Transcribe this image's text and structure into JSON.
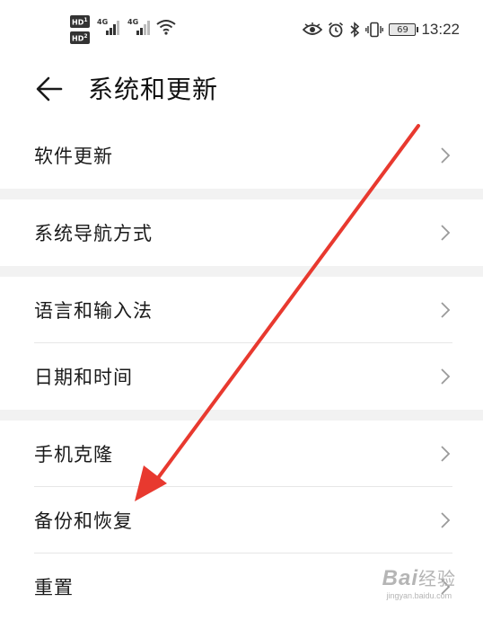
{
  "status_bar": {
    "sim1_label": "HD",
    "sim1_index": "1",
    "sim2_label": "HD",
    "sim2_index": "2",
    "network1": "4G",
    "network2": "4G",
    "battery": "69",
    "time": "13:22",
    "icons": [
      "eye-icon",
      "alarm-icon",
      "bluetooth-icon",
      "vibrate-icon",
      "wifi-icon"
    ]
  },
  "header": {
    "title": "系统和更新",
    "back_icon": "arrow-left-icon"
  },
  "groups": [
    {
      "items": [
        {
          "label": "软件更新"
        }
      ]
    },
    {
      "items": [
        {
          "label": "系统导航方式"
        }
      ]
    },
    {
      "items": [
        {
          "label": "语言和输入法"
        },
        {
          "label": "日期和时间"
        }
      ]
    },
    {
      "items": [
        {
          "label": "手机克隆"
        },
        {
          "label": "备份和恢复"
        },
        {
          "label": "重置"
        }
      ]
    }
  ],
  "annotation": {
    "type": "red-arrow",
    "color": "#e8392f",
    "points_to": "备份和恢复"
  },
  "watermark": {
    "brand": "Bai",
    "brand_cn": "经验",
    "url": "jingyan.baidu.com"
  }
}
